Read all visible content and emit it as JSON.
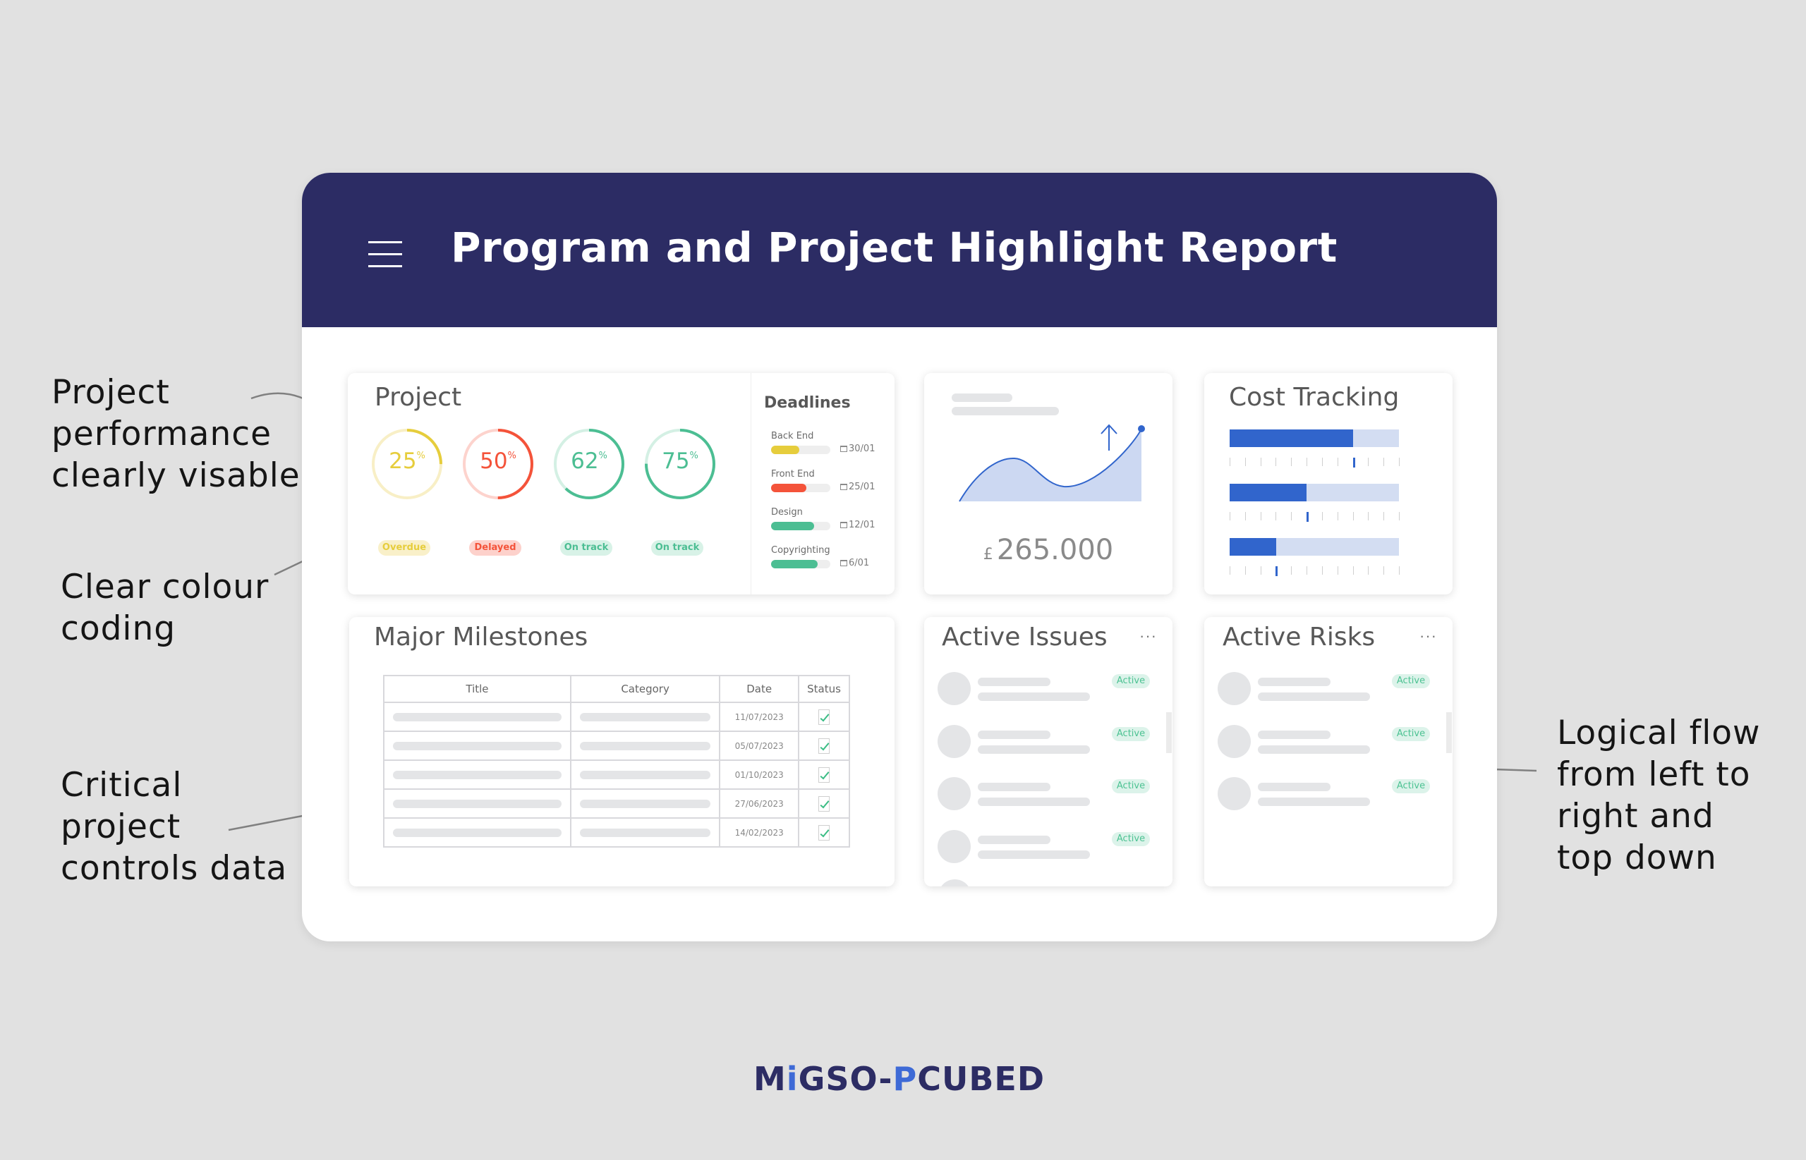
{
  "header": {
    "title": "Program and Project Highlight Report",
    "menu_icon": "hamburger-menu-icon"
  },
  "annotations": [
    {
      "text": "Project\nperformance\nclearly visable"
    },
    {
      "text": "Clear colour\ncoding"
    },
    {
      "text": "Critical\nproject\ncontrols data"
    },
    {
      "text": "Logical flow\nfrom left to\nright and\ntop down"
    }
  ],
  "colors": {
    "header_bg": "#2c2c64",
    "overdue": "#e6cd3c",
    "delayed": "#f4533a",
    "on_track": "#4cbe93",
    "cost_bar": "#3165cc",
    "cost_track": "#d3ddf2"
  },
  "project": {
    "title": "Project",
    "gauges": [
      {
        "percent": 25,
        "value": "25",
        "unit": "%",
        "status": "Overdue",
        "color": "#e6cd3c",
        "track": "#f8efc6",
        "pill_bg": "#f9f0c9"
      },
      {
        "percent": 50,
        "value": "50",
        "unit": "%",
        "status": "Delayed",
        "color": "#f4533a",
        "track": "#fdd3cd",
        "pill_bg": "#fdd1cb"
      },
      {
        "percent": 62,
        "value": "62",
        "unit": "%",
        "status": "On track",
        "color": "#4cbe93",
        "track": "#d4f0e4",
        "pill_bg": "#d8f2e7"
      },
      {
        "percent": 75,
        "value": "75",
        "unit": "%",
        "status": "On track",
        "color": "#4cbe93",
        "track": "#d4f0e4",
        "pill_bg": "#d8f2e7"
      }
    ]
  },
  "deadlines": {
    "title": "Deadlines",
    "items": [
      {
        "label": "Back End",
        "progress": 0.48,
        "date": "30/01",
        "color": "#e6cd3c"
      },
      {
        "label": "Front End",
        "progress": 0.6,
        "date": "25/01",
        "color": "#f4533a"
      },
      {
        "label": "Design",
        "progress": 0.73,
        "date": "12/01",
        "color": "#4cbe93"
      },
      {
        "label": "Copyrighting",
        "progress": 0.78,
        "date": "6/01",
        "color": "#4cbe93"
      }
    ]
  },
  "trend": {
    "amount_currency": "£",
    "amount_value": "265.000",
    "trend_icon": "arrow-up-icon"
  },
  "cost_tracking": {
    "title": "Cost Tracking",
    "bars": [
      {
        "progress": 0.73,
        "marker_index": 8
      },
      {
        "progress": 0.455,
        "marker_index": 5
      },
      {
        "progress": 0.273,
        "marker_index": 3
      }
    ],
    "tick_count": 12
  },
  "milestones": {
    "title": "Major Milestones",
    "columns": [
      "Title",
      "Category",
      "Date",
      "Status"
    ],
    "rows": [
      {
        "date": "11/07/2023",
        "done": true
      },
      {
        "date": "05/07/2023",
        "done": true
      },
      {
        "date": "01/10/2023",
        "done": true
      },
      {
        "date": "27/06/2023",
        "done": true
      },
      {
        "date": "14/02/2023",
        "done": true
      }
    ]
  },
  "issues": {
    "title": "Active Issues",
    "more_label": "···",
    "items": [
      {
        "status": "Active"
      },
      {
        "status": "Active"
      },
      {
        "status": "Active"
      },
      {
        "status": "Active"
      }
    ]
  },
  "risks": {
    "title": "Active Risks",
    "more_label": "···",
    "items": [
      {
        "status": "Active"
      },
      {
        "status": "Active"
      },
      {
        "status": "Active"
      }
    ]
  },
  "logo": {
    "part1": "M",
    "part2": "i",
    "part3": "GSO-",
    "part4": "P",
    "part5": "CUBED"
  }
}
